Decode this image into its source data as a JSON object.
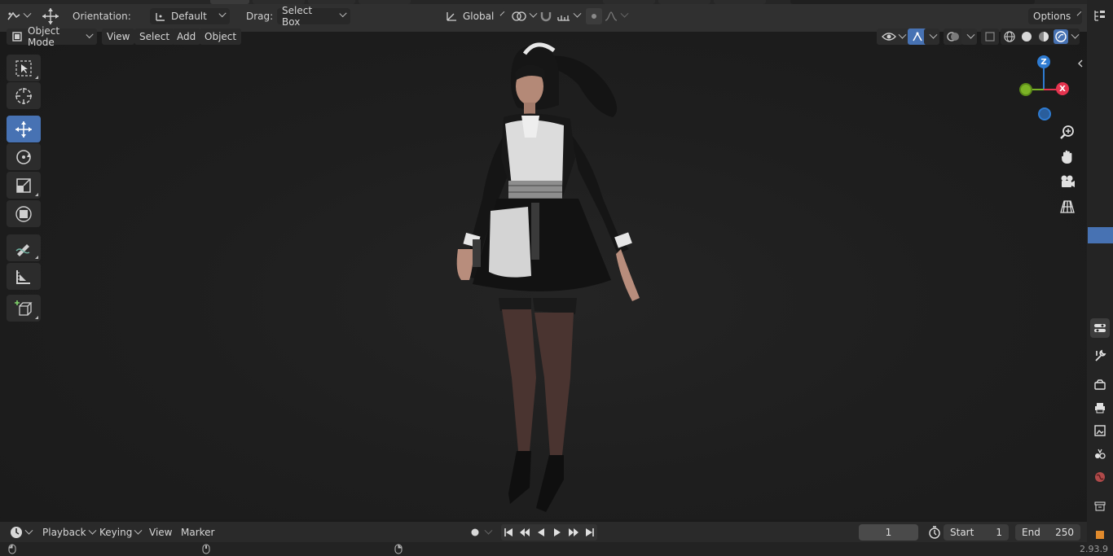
{
  "topbar": {
    "orientation_label": "Orientation:",
    "orientation_value": "Default",
    "drag_label": "Drag:",
    "drag_value": "Select Box",
    "transform_space": "Global",
    "options_label": "Options"
  },
  "header": {
    "mode": "Object Mode",
    "menus": [
      "View",
      "Select",
      "Add",
      "Object"
    ]
  },
  "viewport": {
    "gizmo_axes": {
      "z": "Z",
      "x": "X"
    },
    "axis_colors": {
      "x": "#e5344f",
      "y": "#7cb326",
      "z": "#2e7bd1"
    },
    "accent": "#4772b3"
  },
  "timeline": {
    "menus": [
      "Playback",
      "Keying",
      "View",
      "Marker"
    ],
    "current_frame": "1",
    "start_label": "Start",
    "start_value": "1",
    "end_label": "End",
    "end_value": "250"
  },
  "status": {
    "version": "2.93.9"
  }
}
